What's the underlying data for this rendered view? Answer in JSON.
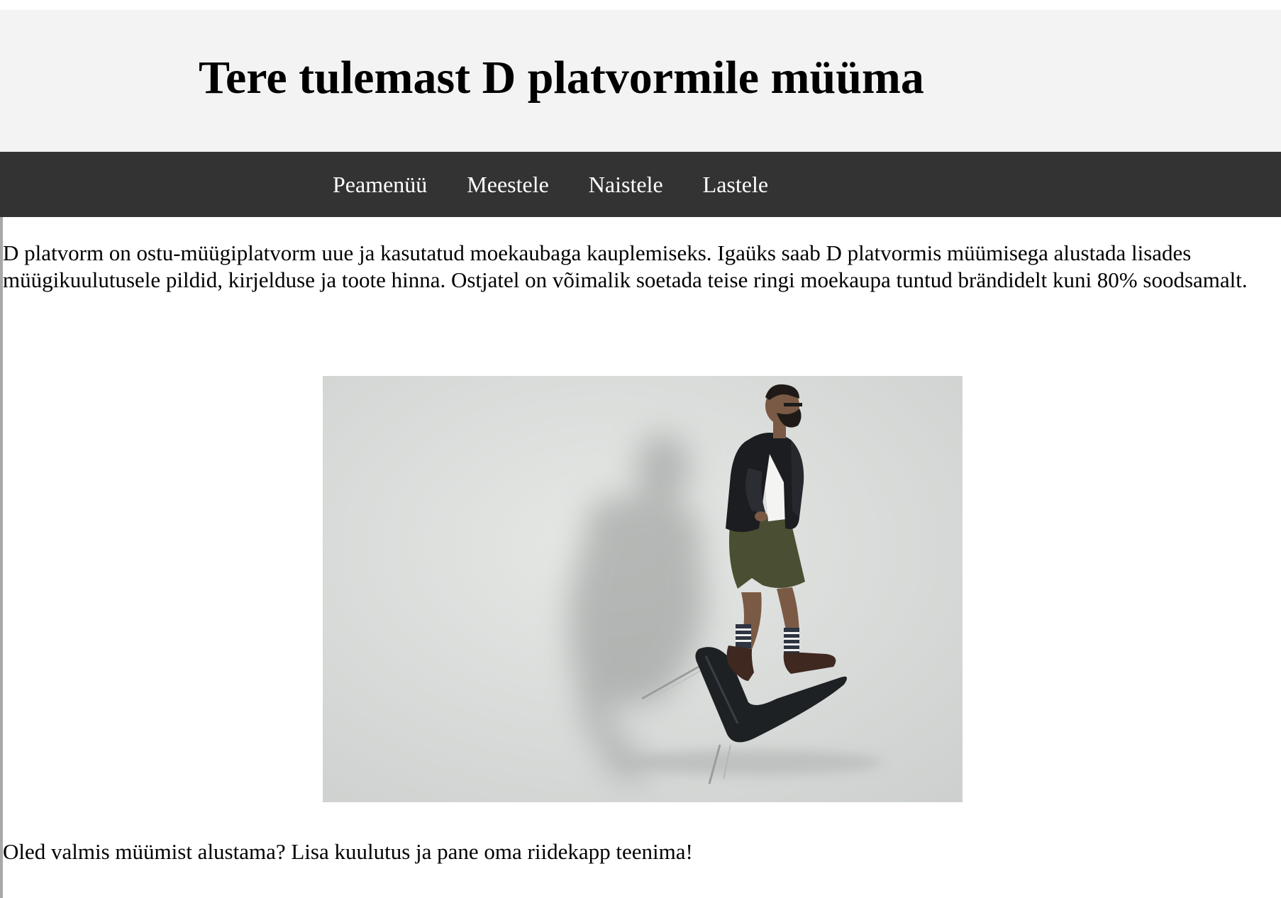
{
  "header": {
    "title": "Tere tulemast D platvormile müüma"
  },
  "nav": {
    "items": [
      {
        "label": "Peamenüü"
      },
      {
        "label": "Meestele"
      },
      {
        "label": "Naistele"
      },
      {
        "label": "Lastele"
      }
    ]
  },
  "main": {
    "intro": "D platvorm on ostu-müügiplatvorm uue ja kasutatud moekaubaga kauplemiseks. Igaüks saab D platvormis müümisega alustada lisades müügikuulutusele pildid, kirjelduse ja toote hinna. Ostjatel on võimalik soetada teise ringi moekaupa tuntud brändidelt kuni 80% soodsamalt.",
    "hero_image_icon": "man-on-chair-photo",
    "cta": "Oled valmis müümist alustama? Lisa kuulutus ja pane oma riidekapp teenima!"
  },
  "colors": {
    "header_bg": "#f3f3f3",
    "nav_bg": "#333333",
    "nav_text": "#ffffff",
    "page_bg": "#ffffff"
  }
}
